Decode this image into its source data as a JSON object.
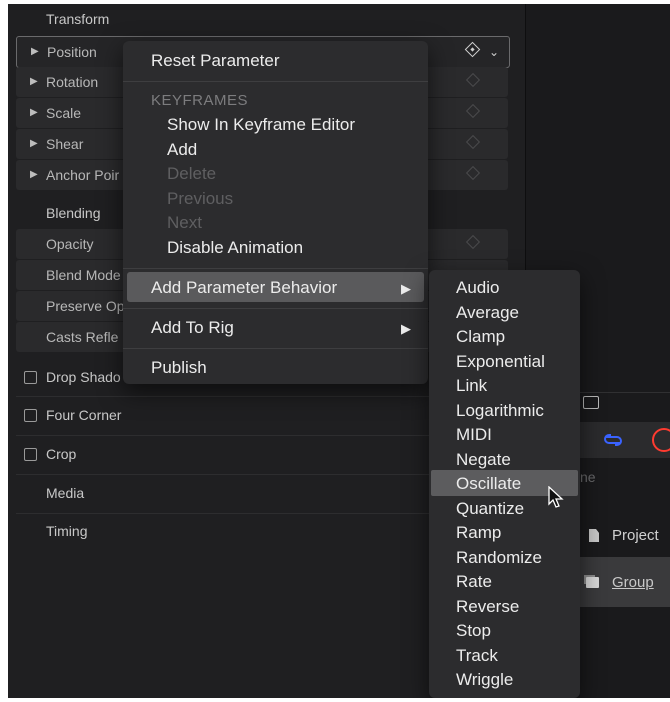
{
  "inspector": {
    "section_transform": "Transform",
    "rows": {
      "position": "Position",
      "rotation": "Rotation",
      "scale": "Scale",
      "shear": "Shear",
      "anchor_point": "Anchor Poir"
    },
    "section_blending": "Blending",
    "blend_rows": {
      "opacity": "Opacity",
      "blend_mode": "Blend Mode",
      "preserve_opacity": "Preserve Op",
      "casts_reflection": "Casts Refle"
    },
    "drop_shadow": "Drop Shado",
    "four_corner": "Four Corner",
    "crop": "Crop",
    "media": "Media",
    "timing": "Timing"
  },
  "context_menu": {
    "reset_parameter": "Reset Parameter",
    "keyframes_header": "KEYFRAMES",
    "show_in_keyframe_editor": "Show In Keyframe Editor",
    "add": "Add",
    "delete": "Delete",
    "previous": "Previous",
    "next": "Next",
    "disable_animation": "Disable Animation",
    "add_parameter_behavior": "Add Parameter Behavior",
    "add_to_rig": "Add To Rig",
    "publish": "Publish"
  },
  "submenu": {
    "items": [
      "Audio",
      "Average",
      "Clamp",
      "Exponential",
      "Link",
      "Logarithmic",
      "MIDI",
      "Negate",
      "Oscillate",
      "Quantize",
      "Ramp",
      "Randomize",
      "Rate",
      "Reverse",
      "Stop",
      "Track",
      "Wriggle"
    ],
    "highlighted": "Oscillate"
  },
  "right_panel": {
    "partial_text": "ne",
    "project_label": "Project",
    "group_label": "Group"
  },
  "colors": {
    "accent_blue": "#3a63ff",
    "record_red": "#ff3b30"
  }
}
